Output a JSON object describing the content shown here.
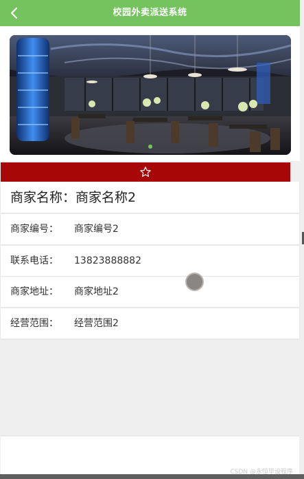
{
  "colors": {
    "header": "#74c35f",
    "favorite_bar": "#a70707",
    "dot_active": "#74c35f"
  },
  "header": {
    "title": "校园外卖派送系统",
    "back_icon": "chevron-left-icon"
  },
  "banner": {
    "slide_count": 1,
    "active_index": 0
  },
  "favorite": {
    "icon": "star-outline-icon"
  },
  "merchant": {
    "name_label": "商家名称：",
    "name_value": "商家名称2",
    "rows": [
      {
        "label": "商家编号：",
        "value": "商家编号2"
      },
      {
        "label": "联系电话：",
        "value": "13823888882"
      },
      {
        "label": "商家地址：",
        "value": "商家地址2"
      },
      {
        "label": "经营范围：",
        "value": "经营范围2"
      }
    ]
  },
  "watermark": "CSDN @永恒毕设程序"
}
